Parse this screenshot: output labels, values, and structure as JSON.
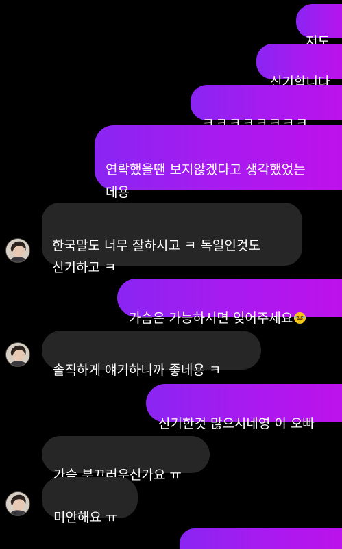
{
  "messages": [
    {
      "side": "sent",
      "text": "저도"
    },
    {
      "side": "sent",
      "text": "신기합니다"
    },
    {
      "side": "sent",
      "text": "ㅋㅋㅋㅋㅋㅋㅋㅋ"
    },
    {
      "side": "sent",
      "text": "연락했을땐 보지않겠다고 생각했었는\n데용"
    },
    {
      "side": "received",
      "text": "한국말도 너무 잘하시고 ㅋ 독일인것도\n신기하고 ㅋ"
    },
    {
      "side": "sent",
      "text": "가슴은 가능하시면 잊어주세요",
      "emoji": "rolling-on-floor-laughing"
    },
    {
      "side": "received",
      "text": "솔직하게 얘기하니까 좋네용 ㅋ"
    },
    {
      "side": "sent",
      "text": "신기한것 많으시네영 이 오빠"
    },
    {
      "side": "received",
      "text": "가슴 부끄러우신가요 ㅠ"
    },
    {
      "side": "received",
      "text": "미안해요 ㅠ"
    }
  ],
  "colors": {
    "background": "#000000",
    "sent_bubble_start": "#8a25f2",
    "sent_bubble_end": "#c010ea",
    "received_bubble": "#262626",
    "text": "#ffffff"
  },
  "icons": {
    "avatar": "profile-photo",
    "emoji": "rolling-on-floor-laughing"
  }
}
